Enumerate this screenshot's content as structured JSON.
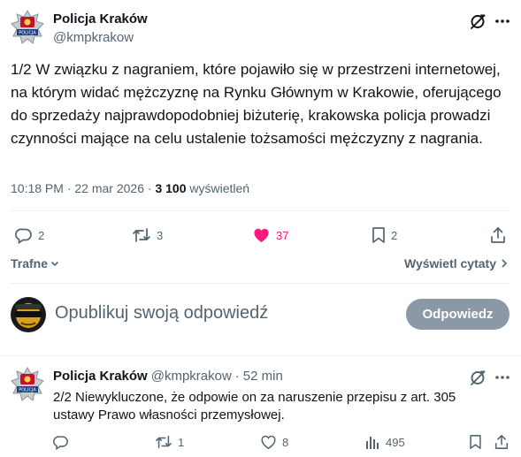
{
  "tweet": {
    "author_name": "Policja Kraków",
    "author_handle": "@kmpkrakow",
    "text": "1/2 W związku z nagraniem, które pojawiło się w przestrzeni internetowej, na którym widać mężczyznę na Rynku Głównym w Krakowie, oferującego do sprzedaży najprawdopodobniej biżuterię, krakowska policja prowadzi czynności mające na celu ustalenie tożsamości mężczyzny z nagrania.",
    "time": "10:18 PM",
    "date": "22 mar 2026",
    "views_count": "3 100",
    "views_label": "wyświetleń",
    "replies": "2",
    "reposts": "3",
    "likes": "37",
    "bookmarks": "2",
    "like_color": "#f91880"
  },
  "sort": {
    "label": "Trafne"
  },
  "quotes": {
    "label": "Wyświetl cytaty"
  },
  "reply_box": {
    "placeholder": "Opublikuj swoją odpowiedź",
    "button_label": "Odpowiedz"
  },
  "reply_tweet": {
    "author_name": "Policja Kraków",
    "author_handle": "@kmpkrakow",
    "separator": "·",
    "time_ago": "52 min",
    "text": "2/2 Niewykluczone, że odpowie on za naruszenie przepisu z art. 305 ustawy Prawo własności przemysłowej.",
    "replies": "",
    "reposts": "1",
    "likes": "8",
    "views": "495"
  },
  "icons": [
    "police-badge-icon",
    "grok-icon",
    "more-icon",
    "reply-icon",
    "repost-icon",
    "like-icon",
    "bookmark-icon",
    "share-icon",
    "chevron-down-icon",
    "chevron-right-icon",
    "views-icon"
  ]
}
